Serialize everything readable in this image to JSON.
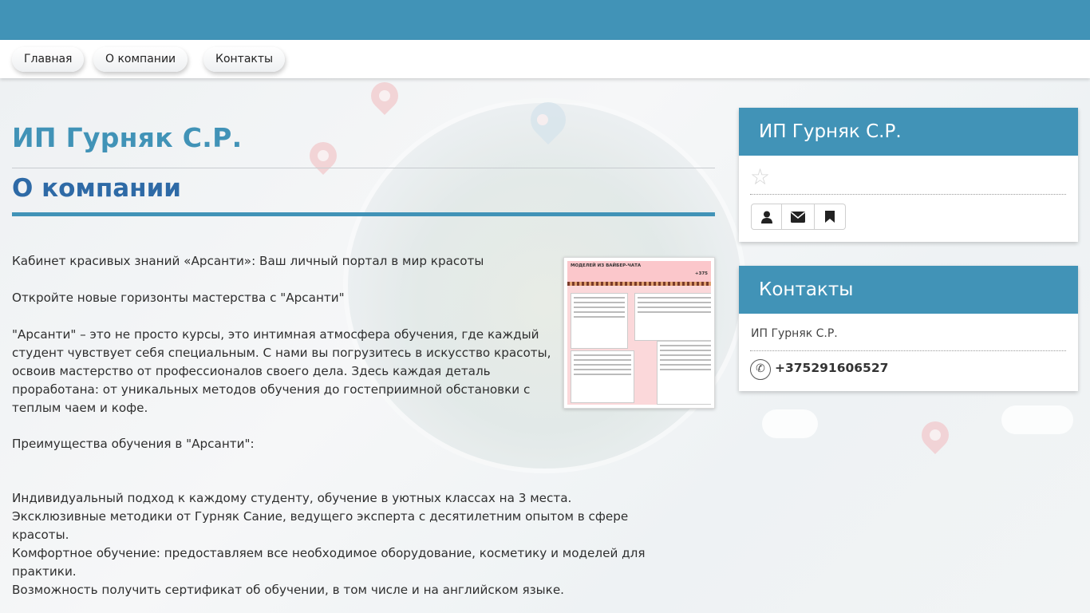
{
  "nav": {
    "items": [
      {
        "label": "Главная"
      },
      {
        "label": "О компании"
      },
      {
        "label": "Контакты"
      }
    ]
  },
  "main": {
    "company_title": "ИП Гурняк С.Р.",
    "section_title": "О компании",
    "paragraphs": [
      "Кабинет красивых знаний «Арсанти»: Ваш личный портал в мир красоты",
      "Откройте новые горизонты мастерства с \"Арсанти\"",
      "\"Арсанти\" – это не просто курсы, это интимная атмосфера обучения, где каждый студент чувствует себя специальным. С нами вы погрузитесь в искусство красоты, освоив мастерство от профессионалов своего дела. Здесь каждая деталь проработана: от уникальных методов обучения до гостеприимной обстановки с теплым чаем и кофе.",
      "Преимущества обучения в \"Арсанти\":",
      "Индивидуальный подход к каждому студенту, обучение в уютных классах на 3 места.",
      "Эксклюзивные методики от Гурняк Сание, ведущего эксперта с десятилетним опытом в сфере красоты.",
      "Комфортное обучение: предоставляем все необходимое оборудование, косметику и моделей для практики.",
      "Возможность получить сертификат об обучении, в том числе и на английском языке."
    ],
    "thumbnail": {
      "header_text": "МОДЕЛЕЙ ИЗ ВАЙБЕР-ЧАТА",
      "phone_fragment": "+375"
    }
  },
  "sidebar": {
    "profile": {
      "title": "ИП Гурняк С.Р.",
      "rating_icon": "star-icon",
      "buttons": [
        {
          "icon": "user-icon"
        },
        {
          "icon": "envelope-icon"
        },
        {
          "icon": "bookmark-icon"
        }
      ]
    },
    "contacts": {
      "title": "Контакты",
      "name": "ИП Гурняк С.Р.",
      "phone": "+375291606527"
    }
  },
  "colors": {
    "brand_blue": "#4193b7",
    "section_title_blue": "#2e6aa6",
    "background": "#f4f6f8"
  }
}
